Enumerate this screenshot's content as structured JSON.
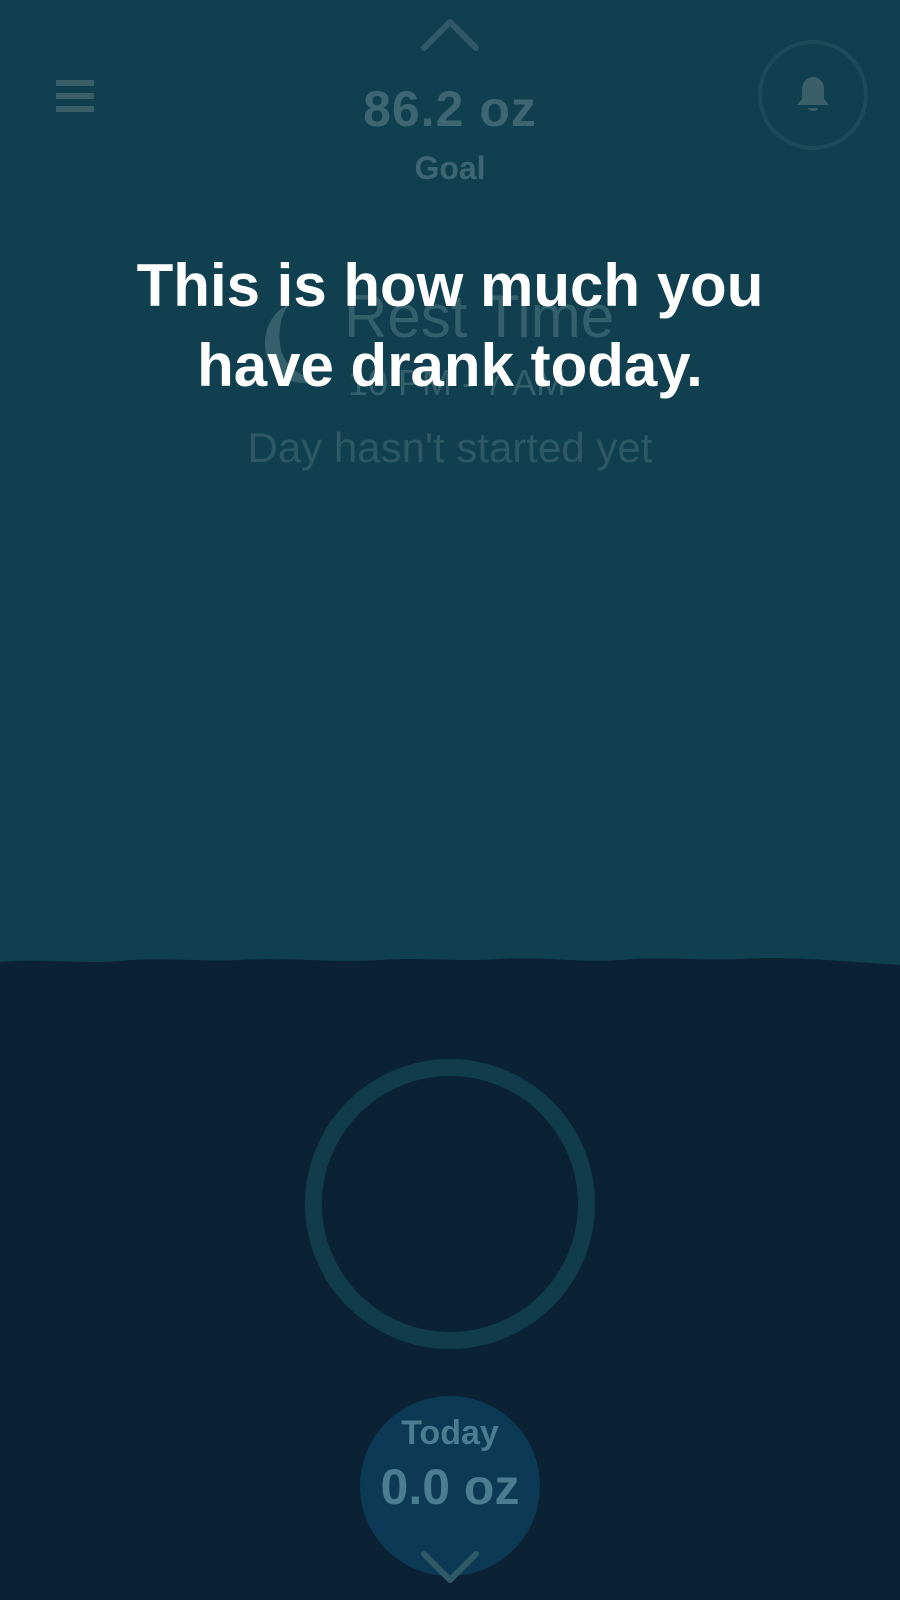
{
  "header": {
    "goal_value": "86.2 oz",
    "goal_label": "Goal"
  },
  "rest": {
    "title": "Rest Time",
    "hours": "10 PM - 7 AM",
    "status": "Day hasn't started yet"
  },
  "tooltip": {
    "line1": "This is how much you",
    "line2": "have drank today."
  },
  "today": {
    "label": "Today",
    "value": "0.0 oz"
  },
  "icons": {
    "menu": "menu-icon",
    "bell": "bell-icon",
    "moon": "moon-icon",
    "up": "chevron-up-icon",
    "down": "chevron-down-icon"
  },
  "colors": {
    "top_background": "#10404f",
    "water": "#0a2233",
    "tooltip_text": "#ffffff",
    "muted_text": "#3e6672"
  }
}
